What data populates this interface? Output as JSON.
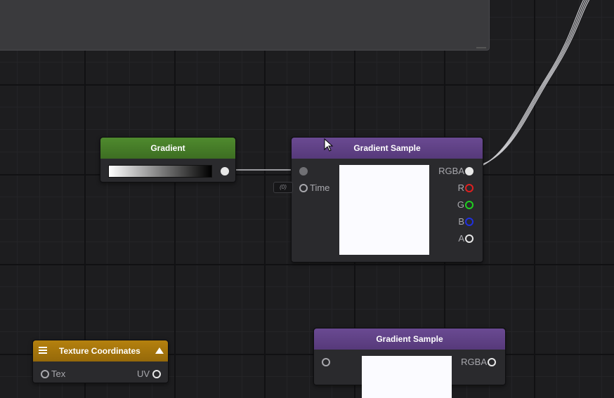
{
  "graph": {
    "nodes": {
      "gradient": {
        "title": "Gradient"
      },
      "gradient_sample": {
        "title": "Gradient Sample",
        "inputs": {
          "time_label": "Time",
          "time_badge": "(0)"
        },
        "outputs": {
          "rgba": "RGBA",
          "r": "R",
          "g": "G",
          "b": "B",
          "a": "A"
        }
      },
      "gradient_sample_2": {
        "title": "Gradient Sample",
        "outputs": {
          "rgba": "RGBA"
        }
      },
      "texture_coordinates": {
        "title": "Texture Coordinates",
        "inputs": {
          "tex": "Tex"
        },
        "outputs": {
          "uv": "UV"
        }
      }
    }
  },
  "colors": {
    "green_header": "#4f8a2e",
    "purple_header": "#6a4a92",
    "orange_header": "#b5810e",
    "socket_r": "#e02020",
    "socket_g": "#20d020",
    "socket_b": "#2030e0"
  },
  "icons": {
    "menu": "hamburger-icon",
    "collapse": "triangle-up-icon",
    "cursor": "mouse-pointer-icon"
  }
}
